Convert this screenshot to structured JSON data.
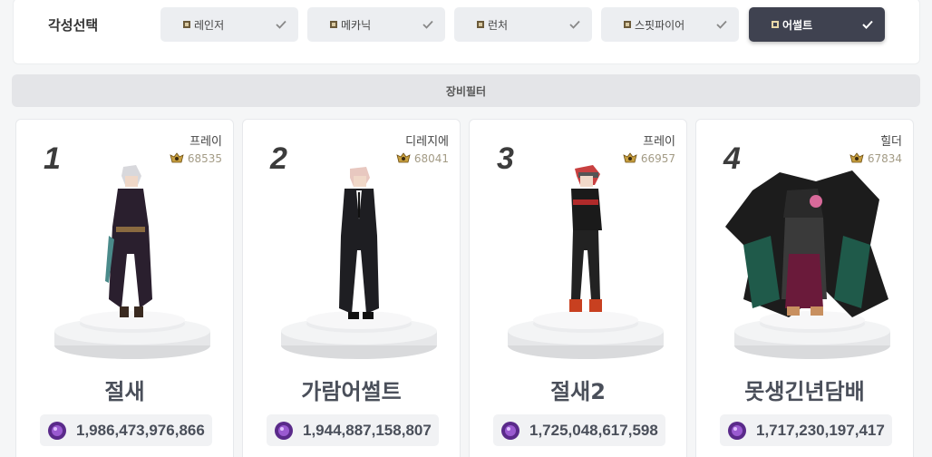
{
  "awakening": {
    "label": "각성선택",
    "options": [
      {
        "label": "레인저",
        "active": false
      },
      {
        "label": "메카닉",
        "active": false
      },
      {
        "label": "런처",
        "active": false
      },
      {
        "label": "스핏파이어",
        "active": false
      },
      {
        "label": "어썰트",
        "active": true
      }
    ]
  },
  "filter": {
    "label": "장비필터"
  },
  "rankings": [
    {
      "rank": "1",
      "server": "프레이",
      "score": "68535",
      "name": "절새",
      "power": "1,986,473,976,866"
    },
    {
      "rank": "2",
      "server": "디레지에",
      "score": "68041",
      "name": "가람어썰트",
      "power": "1,944,887,158,807"
    },
    {
      "rank": "3",
      "server": "프레이",
      "score": "66957",
      "name": "절새2",
      "power": "1,725,048,617,598"
    },
    {
      "rank": "4",
      "server": "힐더",
      "score": "67834",
      "name": "못생긴년담배",
      "power": "1,717,230,197,417"
    }
  ],
  "colors": {
    "active_button": "#3f4250",
    "inactive_button": "#eceef1",
    "score_text": "#a39b85"
  }
}
